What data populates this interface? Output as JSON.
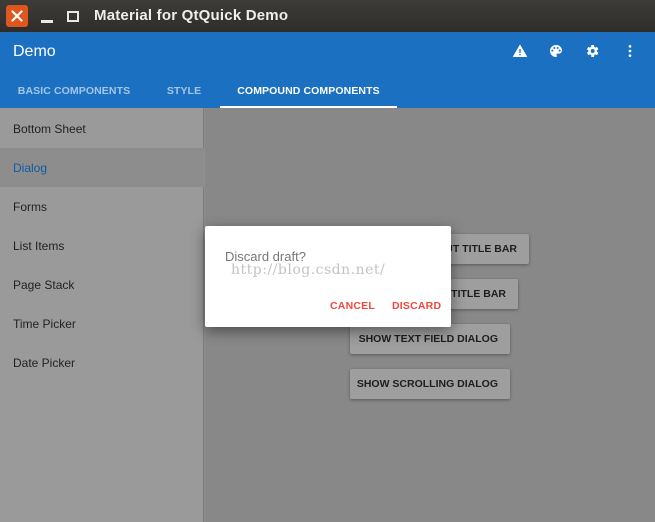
{
  "window": {
    "title": "Material for QtQuick Demo"
  },
  "appbar": {
    "title": "Demo",
    "actions": [
      {
        "icon": "warning-icon"
      },
      {
        "icon": "palette-icon"
      },
      {
        "icon": "settings-icon"
      },
      {
        "icon": "more-vert-icon"
      }
    ],
    "tabs": [
      {
        "label": "BASIC COMPONENTS",
        "active": false
      },
      {
        "label": "STYLE",
        "active": false
      },
      {
        "label": "COMPOUND COMPONENTS",
        "active": true
      }
    ]
  },
  "sidebar": {
    "items": [
      {
        "label": "Bottom Sheet"
      },
      {
        "label": "Dialog",
        "selected": true
      },
      {
        "label": "Forms"
      },
      {
        "label": "List Items"
      },
      {
        "label": "Page Stack"
      },
      {
        "label": "Time Picker"
      },
      {
        "label": "Date Picker"
      }
    ]
  },
  "main": {
    "buttons": [
      {
        "label": "UT TITLE BAR"
      },
      {
        "label": "TITLE BAR"
      },
      {
        "label": "SHOW TEXT FIELD DIALOG"
      },
      {
        "label": "SHOW SCROLLING DIALOG"
      }
    ]
  },
  "dialog": {
    "text": "Discard draft?",
    "watermark": "http://blog.csdn.net/",
    "cancel_label": "CANCEL",
    "discard_label": "DISCARD"
  },
  "colors": {
    "primary": "#1b70c2",
    "accent": "#f0483c",
    "close_button": "#e0561f"
  }
}
